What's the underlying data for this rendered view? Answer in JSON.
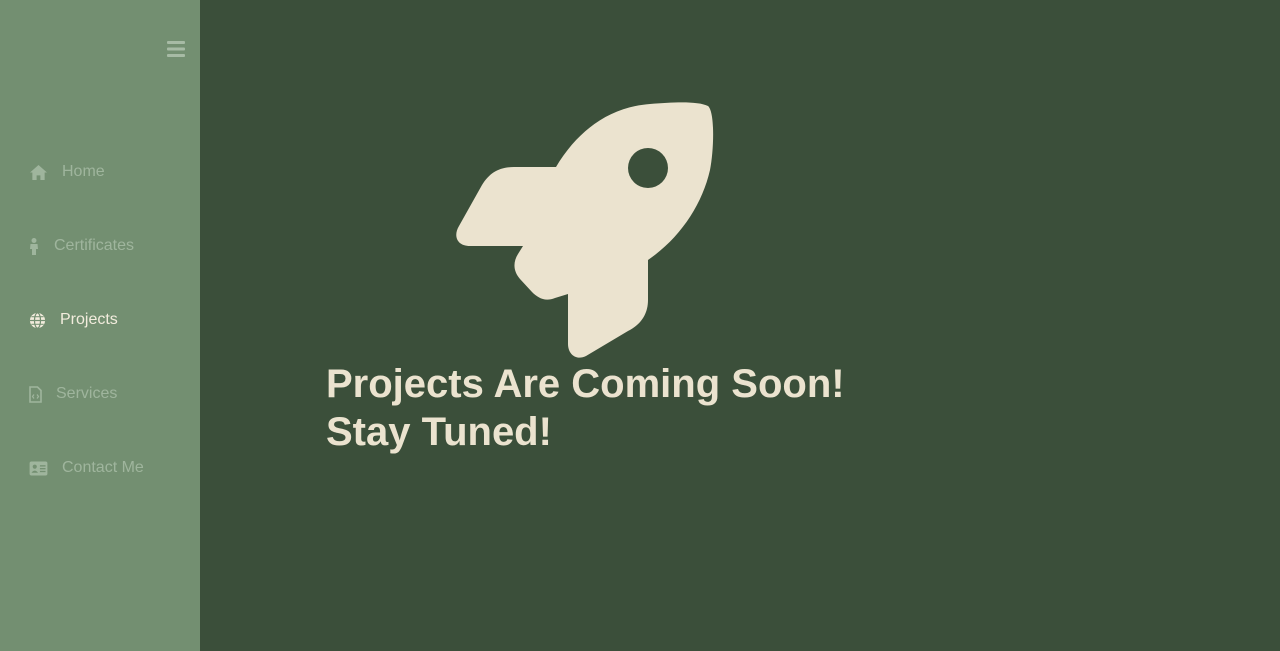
{
  "sidebar": {
    "menu_toggle_icon": "hamburger-menu-icon",
    "items": [
      {
        "label": "Home",
        "icon": "home-icon",
        "active": false
      },
      {
        "label": "Certificates",
        "icon": "person-icon",
        "active": false
      },
      {
        "label": "Projects",
        "icon": "globe-icon",
        "active": true
      },
      {
        "label": "Services",
        "icon": "code-file-icon",
        "active": false
      },
      {
        "label": "Contact Me",
        "icon": "id-card-icon",
        "active": false
      }
    ]
  },
  "main": {
    "hero_icon": "rocket-icon",
    "heading_line1": "Projects Are Coming Soon!",
    "heading_line2": "Stay Tuned!"
  },
  "colors": {
    "sidebar_bg": "#738f71",
    "main_bg": "#3b4f3a",
    "nav_text": "#9fb59d",
    "nav_active_text": "#f2ecdd",
    "accent_cream": "#ebe3cf"
  }
}
